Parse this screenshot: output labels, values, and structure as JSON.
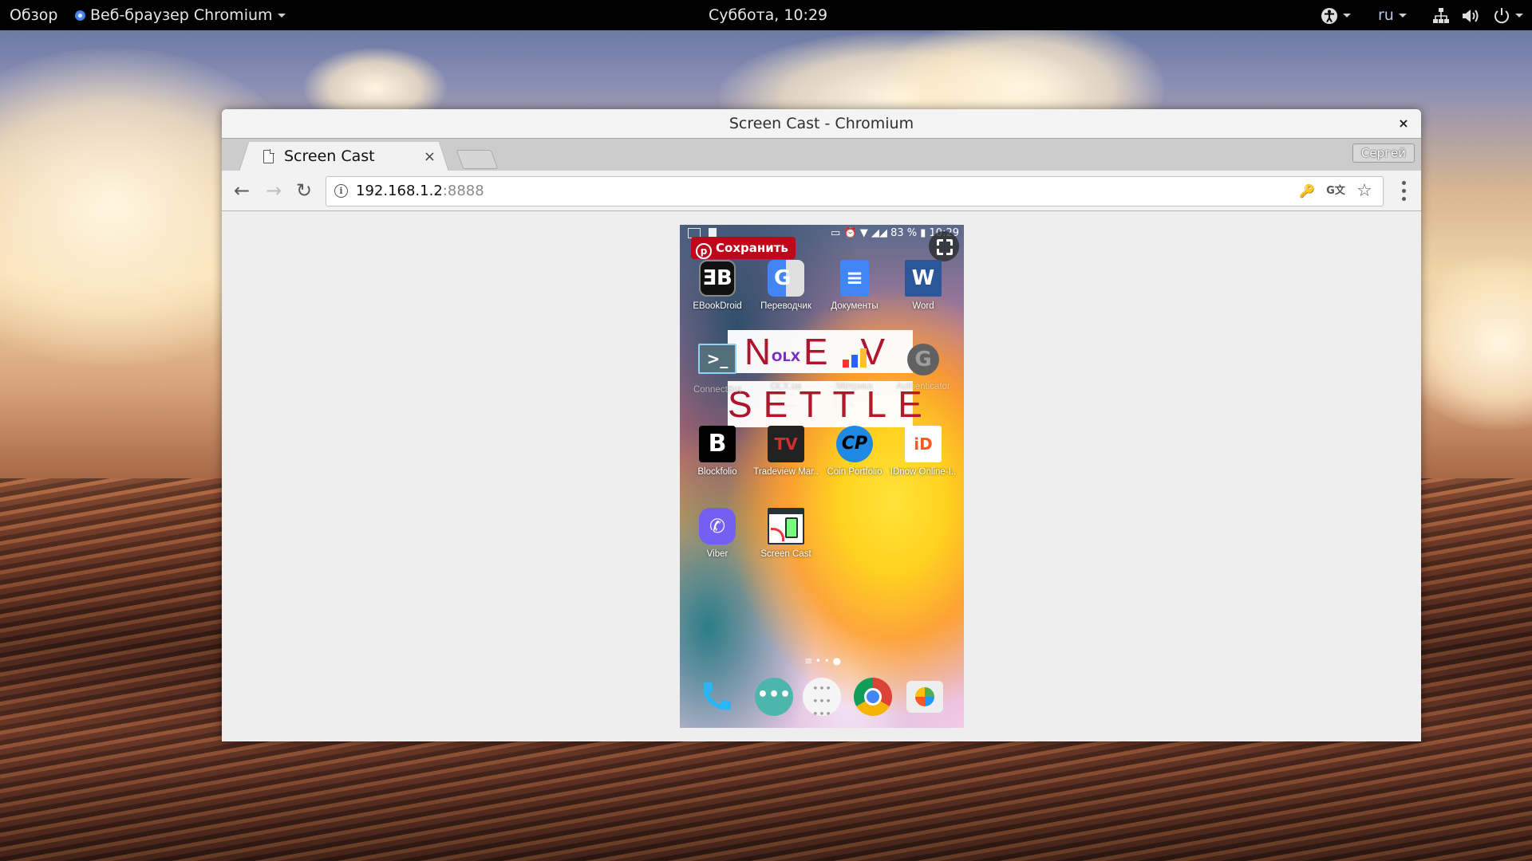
{
  "topbar": {
    "activities": "Обзор",
    "app_menu": "Веб-браузер Chromium",
    "clock": "Суббота, 10:29",
    "language": "ru",
    "icons": [
      "accessibility-icon",
      "network-icon",
      "volume-icon",
      "power-icon"
    ]
  },
  "window": {
    "title": "Screen Cast - Chromium",
    "close_label": "×"
  },
  "tabs": [
    {
      "title": "Screen Cast",
      "close": "×",
      "active": true
    }
  ],
  "profile_name": "Сергей",
  "toolbar": {
    "back": "←",
    "forward": "→",
    "reload": "↻",
    "url_host": "192.168.1.2",
    "url_port": ":8888",
    "info_icon": "i",
    "key_icon": "🔑",
    "translate_icon": "G文",
    "bookmark_icon": "☆"
  },
  "phone": {
    "status": {
      "battery": "83 %",
      "time": "10:29"
    },
    "save_button": "Сохранить",
    "banner_line1": "N E V E R",
    "banner_line2": "SETTLE",
    "apps": [
      {
        "label": "EBookDroid",
        "glyph": "ƎB"
      },
      {
        "label": "Переводчик",
        "glyph": "G"
      },
      {
        "label": "Документы",
        "glyph": "≡"
      },
      {
        "label": "Word",
        "glyph": "W"
      },
      {
        "label": "ConnectBot",
        "glyph": ">_"
      },
      {
        "label": "OLX.ua",
        "glyph": "OLX"
      },
      {
        "label": "Метрика",
        "glyph": ""
      },
      {
        "label": "Authenticator",
        "glyph": "G"
      },
      {
        "label": "Blockfolio",
        "glyph": "B"
      },
      {
        "label": "Tradeview Mar..",
        "glyph": "TV"
      },
      {
        "label": "Coin Portfolio",
        "glyph": "CP"
      },
      {
        "label": "IDnow Online-I..",
        "glyph": "iD"
      },
      {
        "label": "Viber",
        "glyph": "✆"
      },
      {
        "label": "Screen Cast",
        "glyph": ""
      }
    ],
    "page_indicator": "≡ • • ●",
    "dock": [
      "phone-app",
      "messages-app",
      "app-drawer",
      "chrome-app",
      "camera-app"
    ]
  }
}
